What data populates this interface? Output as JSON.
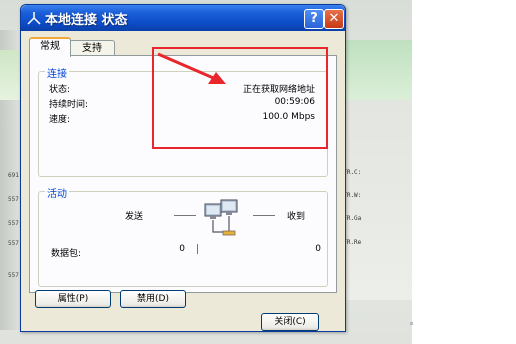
{
  "background": {
    "left_numbers": [
      "691",
      "557",
      "557",
      "557",
      "557"
    ],
    "right_rows": [
      "复] TR.C:",
      "复] TR.W:",
      "复] TR.Ga",
      "复] TR.Re"
    ]
  },
  "dialog": {
    "title": "本地连接 状态",
    "help_label": "?",
    "close_label": "✕",
    "tabs": [
      "常规",
      "支持"
    ],
    "connection": {
      "group_label": "连接",
      "status_label": "状态:",
      "status_value": "正在获取网络地址",
      "duration_label": "持续时间:",
      "duration_value": "00:59:06",
      "speed_label": "速度:",
      "speed_value": "100.0 Mbps"
    },
    "activity": {
      "group_label": "活动",
      "sent_label": "发送",
      "received_label": "收到",
      "packets_label": "数据包:",
      "packets_sent": "0",
      "packets_received": "0"
    },
    "buttons": {
      "properties": "属性(P)",
      "disable": "禁用(D)",
      "close": "关闭(C)"
    }
  },
  "colors": {
    "titlebar": "#0d4cc8",
    "annotation": "#e8262b",
    "group_label": "#0046d5"
  }
}
